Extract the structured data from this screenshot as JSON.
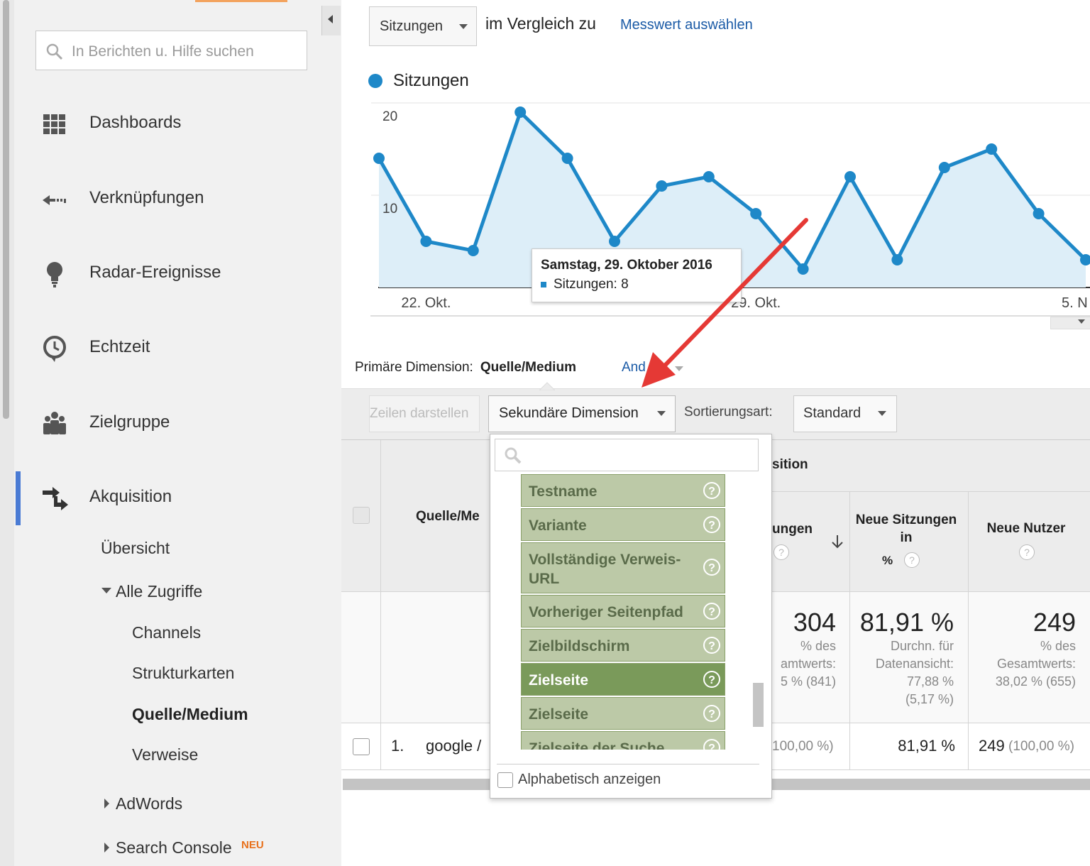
{
  "sidebar": {
    "search_placeholder": "In Berichten u. Hilfe suchen",
    "nav": [
      {
        "label": "Dashboards",
        "icon": "grid-icon"
      },
      {
        "label": "Verknüpfungen",
        "icon": "shortcut-arrow-icon"
      },
      {
        "label": "Radar-Ereignisse",
        "icon": "lightbulb-icon"
      },
      {
        "label": "Echtzeit",
        "icon": "clock-icon"
      },
      {
        "label": "Zielgruppe",
        "icon": "people-icon"
      },
      {
        "label": "Akquisition",
        "icon": "acquisition-arrows-icon"
      }
    ],
    "sub": {
      "uebersicht": "Übersicht",
      "alle_zugriffe": "Alle Zugriffe",
      "channels": "Channels",
      "strukturkarten": "Strukturkarten",
      "quelle_medium": "Quelle/Medium",
      "verweise": "Verweise",
      "adwords": "AdWords",
      "search_console": "Search Console",
      "neu_badge": "NEU"
    },
    "accent_color": "#4a7bd4"
  },
  "header": {
    "metric_select": "Sitzungen",
    "compare_text": "im Vergleich zu",
    "choose_metric_link": "Messwert auswählen"
  },
  "chart_data": {
    "type": "area",
    "series": [
      {
        "name": "Sitzungen",
        "color": "#1e88c8",
        "values": [
          14,
          5,
          4,
          19,
          14,
          5,
          11,
          12,
          8,
          2,
          12,
          3,
          13,
          15,
          8,
          3
        ]
      }
    ],
    "ylim": [
      0,
      20
    ],
    "yticks": [
      "20",
      "10"
    ],
    "xtick_labels": [
      "22. Okt.",
      "29. Okt.",
      "5. N"
    ],
    "legend": "Sitzungen",
    "grid": true
  },
  "tooltip": {
    "date": "Samstag, 29. Oktober 2016",
    "value": "Sitzungen: 8"
  },
  "dimension_bar": {
    "primary_label": "Primäre Dimension:",
    "primary_value": "Quelle/Medium",
    "other_link": "And"
  },
  "toolbar": {
    "plot_rows": "Zeilen darstellen",
    "secondary_dimension": "Sekundäre Dimension",
    "sort_label": "Sortierungsart:",
    "sort_value": "Standard"
  },
  "table": {
    "group_header": "sition",
    "col_source": "Quelle/Me",
    "col_sessions": "ungen",
    "col_new_sessions": "Neue Sitzungen in",
    "col_new_sessions_pct": "%",
    "col_new_users": "Neue Nutzer",
    "totals": {
      "sessions": "304",
      "sessions_sub1": "% des",
      "sessions_sub2": "amtwerts:",
      "sessions_sub3": "5 % (841)",
      "new_sessions": "81,91 %",
      "new_sessions_sub1": "Durchn. für",
      "new_sessions_sub2": "Datenansicht:",
      "new_sessions_sub3": "77,88 %",
      "new_sessions_sub4": "(5,17 %)",
      "new_users": "249",
      "new_users_sub1": "% des",
      "new_users_sub2": "Gesamtwerts:",
      "new_users_sub3": "38,02 % (655)"
    },
    "rows": [
      {
        "index": "1.",
        "source": "google /",
        "sessions_pct": "100,00 %)",
        "new_sessions": "81,91 %",
        "new_users": "249",
        "new_users_pct": "(100,00 %)"
      }
    ]
  },
  "dropdown": {
    "items": [
      {
        "label": "Testname",
        "active": false
      },
      {
        "label": "Variante",
        "active": false
      },
      {
        "label": "Vollständige Verweis-URL",
        "active": false
      },
      {
        "label": "Vorheriger Seitenpfad",
        "active": false
      },
      {
        "label": "Zielbildschirm",
        "active": false
      },
      {
        "label": "Zielseite",
        "active": true
      },
      {
        "label": "Zielseite",
        "active": false
      },
      {
        "label": "Zielseite der Suche",
        "active": false
      }
    ],
    "alphabetic_label": "Alphabetisch anzeigen",
    "item_color": "#bcc9a7",
    "active_color": "#7a9a5a"
  }
}
